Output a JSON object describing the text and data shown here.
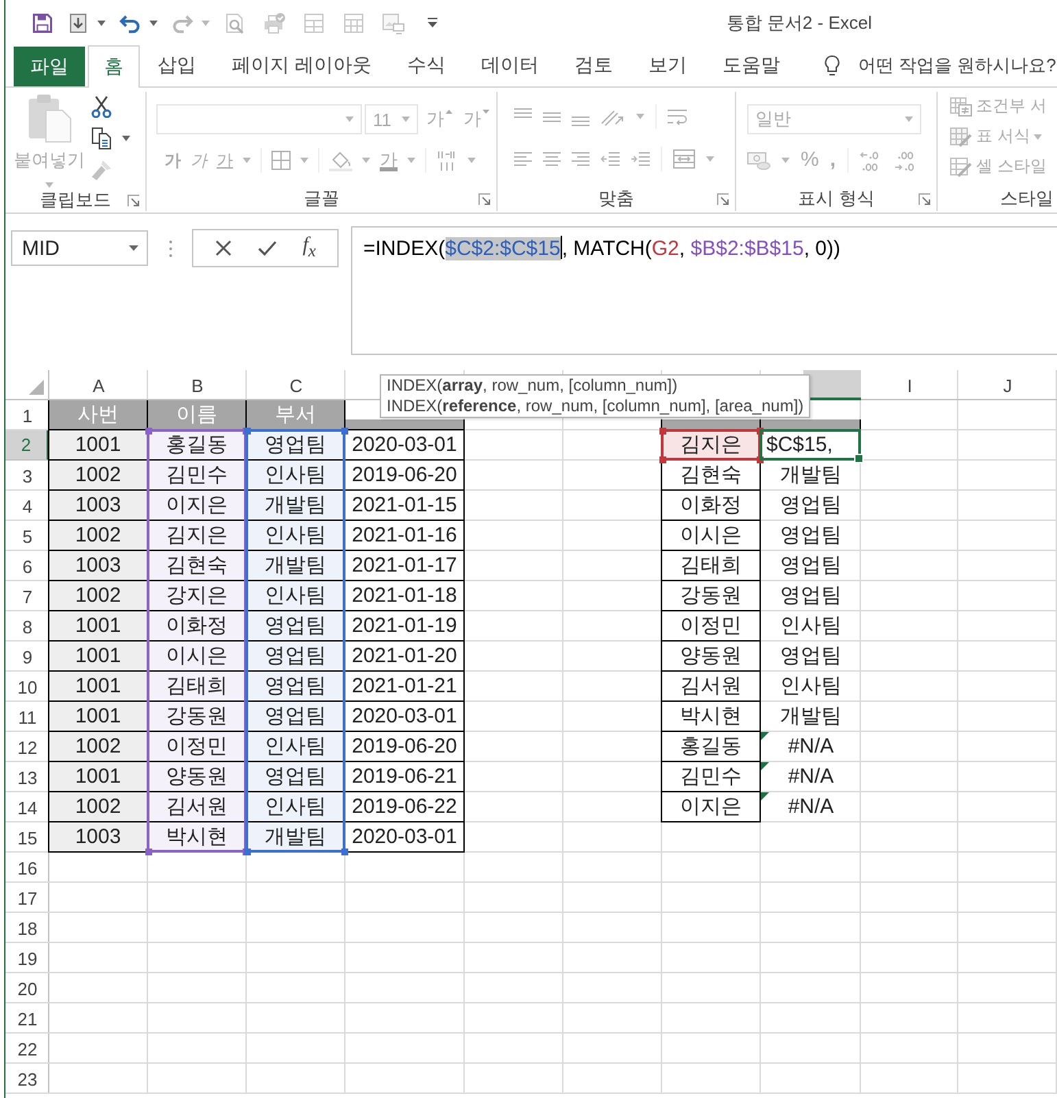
{
  "window": {
    "title": "통합 문서2 - Excel"
  },
  "quick_access": [
    {
      "kind": "save",
      "dropdown": false,
      "disabled": false
    },
    {
      "kind": "touch",
      "dropdown": true,
      "disabled": false
    },
    {
      "kind": "undo",
      "dropdown": true,
      "disabled": false
    },
    {
      "kind": "redo",
      "dropdown": true,
      "disabled": true
    },
    {
      "kind": "preview",
      "dropdown": false,
      "disabled": true
    },
    {
      "kind": "print",
      "dropdown": false,
      "disabled": true
    },
    {
      "kind": "table",
      "dropdown": false,
      "disabled": true
    },
    {
      "kind": "grid",
      "dropdown": false,
      "disabled": true
    },
    {
      "kind": "picture",
      "dropdown": false,
      "disabled": true
    }
  ],
  "ribbon_tabs": [
    {
      "label": "파일",
      "kind": "file",
      "selected": false
    },
    {
      "label": "홈",
      "kind": "tab",
      "selected": true
    },
    {
      "label": "삽입",
      "kind": "tab",
      "selected": false
    },
    {
      "label": "페이지 레이아웃",
      "kind": "tab",
      "selected": false
    },
    {
      "label": "수식",
      "kind": "tab",
      "selected": false
    },
    {
      "label": "데이터",
      "kind": "tab",
      "selected": false
    },
    {
      "label": "검토",
      "kind": "tab",
      "selected": false
    },
    {
      "label": "보기",
      "kind": "tab",
      "selected": false
    },
    {
      "label": "도움말",
      "kind": "tab",
      "selected": false
    }
  ],
  "tell_me": {
    "label": "어떤 작업을 원하시나요?"
  },
  "ribbon": {
    "clipboard": {
      "label": "클립보드",
      "paste": {
        "label": "붙여넣기",
        "disabled": true
      },
      "tools": [
        {
          "kind": "cut",
          "disabled": false
        },
        {
          "kind": "copy",
          "disabled": false
        },
        {
          "kind": "format_painter",
          "disabled": true
        }
      ]
    },
    "font": {
      "label": "글꼴",
      "disabled": true,
      "size": "11",
      "grow": "가",
      "shrink": "가",
      "bold": "가",
      "italic": "가",
      "underline": "가",
      "font_color": "가"
    },
    "alignment": {
      "label": "맞춤",
      "disabled": true
    },
    "number": {
      "label": "표시 형식",
      "disabled": true,
      "format": "일반",
      "percent": "%",
      "comma": ","
    },
    "styles": {
      "label": "스타일",
      "disabled": true,
      "items": [
        {
          "kind": "conditional",
          "label": "조건부 서",
          "dropdown": false
        },
        {
          "kind": "table",
          "label": "표 서식",
          "dropdown": true
        },
        {
          "kind": "cell",
          "label": "셀 스타일",
          "dropdown": false
        }
      ]
    }
  },
  "name_box": {
    "value": "MID"
  },
  "formula_bar": {
    "fx": "f$_{x}$",
    "segments": [
      {
        "text": "=INDEX(",
        "color": "#000000",
        "selected": false
      },
      {
        "text": "$C$2:$C$15",
        "color": "#2a5fbd",
        "selected": true
      },
      {
        "text": ", MATCH(",
        "color": "#000000",
        "selected": false
      },
      {
        "text": "G2",
        "color": "#c0373c",
        "selected": false
      },
      {
        "text": ", ",
        "color": "#000000",
        "selected": false
      },
      {
        "text": "$B$2:$B$15",
        "color": "#8450c0",
        "selected": false
      },
      {
        "text": ", 0))",
        "color": "#000000",
        "selected": false
      }
    ]
  },
  "function_tooltip": {
    "lines": [
      "INDEX(**array**, row_num, [column_num])",
      "INDEX(**reference**, row_num, [column_num], [area_num])"
    ]
  },
  "sheet": {
    "columns": [
      {
        "label": "A",
        "selected": false
      },
      {
        "label": "B",
        "selected": false
      },
      {
        "label": "C",
        "selected": false
      },
      {
        "selected": true
      },
      {
        "label": "I",
        "selected": false
      },
      {
        "label": "J",
        "selected": false
      }
    ],
    "rows": [
      {
        "label": "1",
        "selected": false
      },
      {
        "label": "2",
        "selected": true
      },
      {
        "label": "3",
        "selected": false
      },
      {
        "label": "4",
        "selected": false
      },
      {
        "label": "5",
        "selected": false
      },
      {
        "label": "6",
        "selected": false
      },
      {
        "label": "7",
        "selected": false
      },
      {
        "label": "8",
        "selected": false
      },
      {
        "label": "9",
        "selected": false
      },
      {
        "label": "10",
        "selected": false
      },
      {
        "label": "11",
        "selected": false
      },
      {
        "label": "12",
        "selected": false
      },
      {
        "label": "13",
        "selected": false
      },
      {
        "label": "14",
        "selected": false
      },
      {
        "label": "15",
        "selected": false
      },
      {
        "label": "16",
        "selected": false
      },
      {
        "label": "17",
        "selected": false
      },
      {
        "label": "18",
        "selected": false
      },
      {
        "label": "19",
        "selected": false
      },
      {
        "label": "20",
        "selected": false
      },
      {
        "label": "21",
        "selected": false
      },
      {
        "label": "22",
        "selected": false
      },
      {
        "label": "23",
        "selected": false
      }
    ]
  },
  "employee_table": {
    "columns": [
      {
        "header": "사번",
        "kind": "shaded"
      },
      {
        "header": "이름",
        "kind": "reference",
        "color": "#8a63c6"
      },
      {
        "header": "부서",
        "kind": "reference",
        "color": "#3c6fcf"
      },
      {
        "kind": "plain"
      }
    ],
    "rows": [
      [
        "1001",
        "홍길동",
        "영업팀",
        "2020-03-01"
      ],
      [
        "1002",
        "김민수",
        "인사팀",
        "2019-06-20"
      ],
      [
        "1003",
        "이지은",
        "개발팀",
        "2021-01-15"
      ],
      [
        "1002",
        "김지은",
        "인사팀",
        "2021-01-16"
      ],
      [
        "1003",
        "김현숙",
        "개발팀",
        "2021-01-17"
      ],
      [
        "1002",
        "강지은",
        "인사팀",
        "2021-01-18"
      ],
      [
        "1001",
        "이화정",
        "영업팀",
        "2021-01-19"
      ],
      [
        "1001",
        "이시은",
        "영업팀",
        "2021-01-20"
      ],
      [
        "1001",
        "김태희",
        "영업팀",
        "2021-01-21"
      ],
      [
        "1001",
        "강동원",
        "영업팀",
        "2020-03-01"
      ],
      [
        "1002",
        "이정민",
        "인사팀",
        "2019-06-20"
      ],
      [
        "1001",
        "양동원",
        "영업팀",
        "2019-06-21"
      ],
      [
        "1002",
        "김서원",
        "인사팀",
        "2019-06-22"
      ],
      [
        "1003",
        "박시현",
        "개발팀",
        "2020-03-01"
      ]
    ]
  },
  "lookup_table": {
    "rows": [
      {
        "name": "김지은",
        "result": "$C$15,",
        "referenced": true,
        "active": true,
        "error": false
      },
      {
        "name": "김현숙",
        "result": "개발팀",
        "referenced": false,
        "active": false,
        "error": false
      },
      {
        "name": "이화정",
        "result": "영업팀",
        "referenced": false,
        "active": false,
        "error": false
      },
      {
        "name": "이시은",
        "result": "영업팀",
        "referenced": false,
        "active": false,
        "error": false
      },
      {
        "name": "김태희",
        "result": "영업팀",
        "referenced": false,
        "active": false,
        "error": false
      },
      {
        "name": "강동원",
        "result": "영업팀",
        "referenced": false,
        "active": false,
        "error": false
      },
      {
        "name": "이정민",
        "result": "인사팀",
        "referenced": false,
        "active": false,
        "error": false
      },
      {
        "name": "양동원",
        "result": "영업팀",
        "referenced": false,
        "active": false,
        "error": false
      },
      {
        "name": "김서원",
        "result": "인사팀",
        "referenced": false,
        "active": false,
        "error": false
      },
      {
        "name": "박시현",
        "result": "개발팀",
        "referenced": false,
        "active": false,
        "error": false
      },
      {
        "name": "홍길동",
        "result": "#N/A",
        "referenced": false,
        "active": false,
        "error": true
      },
      {
        "name": "김민수",
        "result": "#N/A",
        "referenced": false,
        "active": false,
        "error": true
      },
      {
        "name": "이지은",
        "result": "#N/A",
        "referenced": false,
        "active": false,
        "error": true
      }
    ]
  }
}
